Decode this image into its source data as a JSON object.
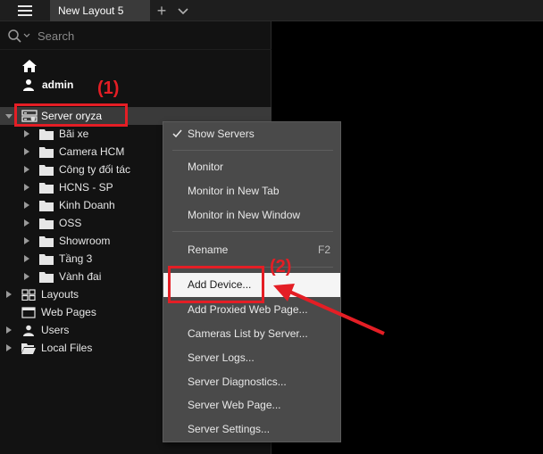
{
  "topbar": {
    "tab_label": "New Layout 5",
    "add_tab_glyph": "+",
    "menu_icon": "hamburger-icon",
    "more_icon": "chevron-down-icon"
  },
  "search": {
    "placeholder": "Search"
  },
  "user": {
    "name": "admin"
  },
  "annotations": {
    "step1": "(1)",
    "step2": "(2)",
    "color": "#e41e25"
  },
  "server": {
    "label": "Server oryza"
  },
  "server_children": [
    {
      "label": "Bãi xe"
    },
    {
      "label": "Camera HCM"
    },
    {
      "label": "Công ty đối tác"
    },
    {
      "label": "HCNS - SP"
    },
    {
      "label": "Kinh Doanh"
    },
    {
      "label": "OSS"
    },
    {
      "label": "Showroom"
    },
    {
      "label": "Tầng 3"
    },
    {
      "label": "Vành đai"
    }
  ],
  "top_nodes": [
    {
      "label": "Layouts",
      "expandable": true
    },
    {
      "label": "Web Pages",
      "expandable": false
    },
    {
      "label": "Users",
      "expandable": true
    },
    {
      "label": "Local Files",
      "expandable": true
    }
  ],
  "context_menu": {
    "show_servers": "Show Servers",
    "monitor": "Monitor",
    "monitor_new_tab": "Monitor in New Tab",
    "monitor_new_window": "Monitor in New Window",
    "rename": "Rename",
    "rename_shortcut": "F2",
    "add_device": "Add Device...",
    "add_proxied": "Add Proxied Web Page...",
    "cameras_list": "Cameras List by Server...",
    "server_logs": "Server Logs...",
    "server_diagnostics": "Server Diagnostics...",
    "server_web_page": "Server Web Page...",
    "server_settings": "Server Settings..."
  },
  "colors": {
    "accent_red": "#e41e25",
    "menu_bg": "#4a4a4a",
    "panel_bg": "#121212",
    "selected_row": "#3a3a3a"
  }
}
